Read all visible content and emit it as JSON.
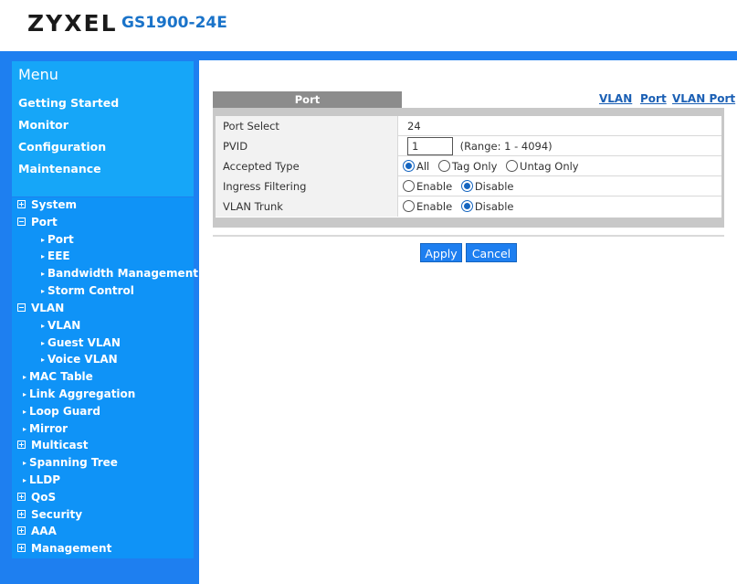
{
  "header": {
    "logo": "ZYXEL",
    "model": "GS1900-24E"
  },
  "menu": {
    "title": "Menu",
    "links": [
      "Getting Started",
      "Monitor",
      "Configuration",
      "Maintenance"
    ]
  },
  "tree": {
    "system": "System",
    "port": "Port",
    "port_port": "Port",
    "port_eee": "EEE",
    "port_bw": "Bandwidth Management",
    "port_storm": "Storm Control",
    "vlan": "VLAN",
    "vlan_vlan": "VLAN",
    "vlan_guest": "Guest VLAN",
    "vlan_voice": "Voice VLAN",
    "mac": "MAC Table",
    "lag": "Link Aggregation",
    "loop": "Loop Guard",
    "mirror": "Mirror",
    "multicast": "Multicast",
    "stp": "Spanning Tree",
    "lldp": "LLDP",
    "qos": "QoS",
    "security": "Security",
    "aaa": "AAA",
    "management": "Management"
  },
  "content": {
    "tab_label": "Port",
    "nav_links": [
      "VLAN",
      "Port",
      "VLAN Port"
    ],
    "rows": {
      "port_select": {
        "label": "Port Select",
        "value": "24"
      },
      "pvid": {
        "label": "PVID",
        "value": "1",
        "range": "(Range: 1 - 4094)"
      },
      "accepted_type": {
        "label": "Accepted Type",
        "options": [
          "All",
          "Tag Only",
          "Untag Only"
        ],
        "selected": "All"
      },
      "ingress": {
        "label": "Ingress Filtering",
        "options": [
          "Enable",
          "Disable"
        ],
        "selected": "Disable"
      },
      "vlan_trunk": {
        "label": "VLAN Trunk",
        "options": [
          "Enable",
          "Disable"
        ],
        "selected": "Disable"
      }
    },
    "apply_label": "Apply",
    "cancel_label": "Cancel"
  },
  "colors": {
    "accent": "#1e7ff0",
    "menu_box": "#16a6f8",
    "model_text": "#1a73c9"
  }
}
